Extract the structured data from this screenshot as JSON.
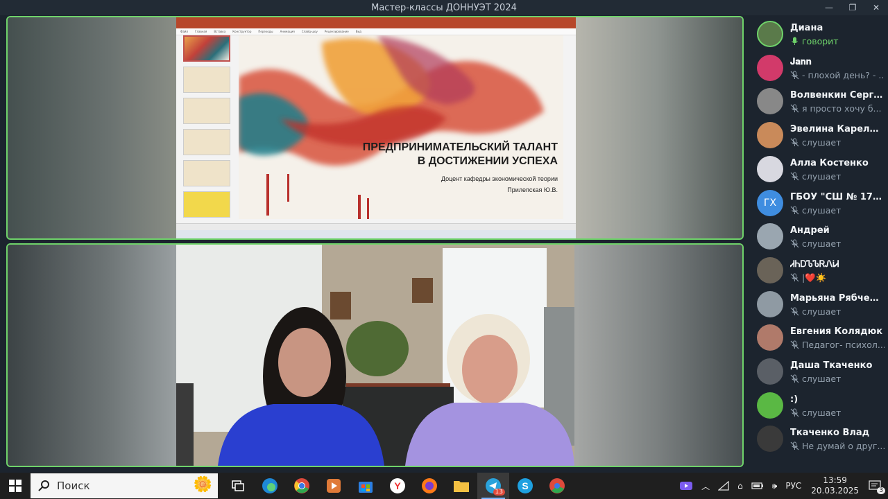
{
  "window": {
    "title": "Мастер-классы ДОННУЭТ 2024",
    "controls": [
      "minimize",
      "maximize",
      "close"
    ]
  },
  "slide": {
    "heading_line1": "ПРЕДПРИНИМАТЕЛЬСКИЙ ТАЛАНТ",
    "heading_line2": "В ДОСТИЖЕНИИ УСПЕХА",
    "subtitle": "Доцент кафедры экономической теории",
    "author": "Прилепская Ю.В."
  },
  "participants": [
    {
      "name": "Диана",
      "status": "говорит",
      "speaking": true,
      "avatar_color": "#5a7a4a",
      "initials": ""
    },
    {
      "name": "𝐉𝐚𝐧𝐧",
      "status": "- плохой день? - ...",
      "speaking": false,
      "avatar_color": "#d23a6a",
      "initials": ""
    },
    {
      "name": "Волвенкин Сергей",
      "status": "я просто хочу б...",
      "speaking": false,
      "avatar_color": "#888888",
      "initials": ""
    },
    {
      "name": "Эвелина Карелова",
      "status": "слушает",
      "speaking": false,
      "avatar_color": "#c98a5a",
      "initials": ""
    },
    {
      "name": "Алла Костенко",
      "status": "слушает",
      "speaking": false,
      "avatar_color": "#d8d8e0",
      "initials": ""
    },
    {
      "name": "ГБОУ \"СШ № 17 г....",
      "status": "слушает",
      "speaking": false,
      "avatar_color": "#3f8de0",
      "initials": "ГХ"
    },
    {
      "name": "Андрей",
      "status": "слушает",
      "speaking": false,
      "avatar_color": "#9aa6b0",
      "initials": ""
    },
    {
      "name": "ᏗᏂᎠᏖᏖᏒᏁᎥᏗ",
      "status": "|❤️☀️",
      "speaking": false,
      "avatar_color": "#6a6358",
      "initials": ""
    },
    {
      "name": "Марьяна Рябченко",
      "status": "слушает",
      "speaking": false,
      "avatar_color": "#8f9aa3",
      "initials": ""
    },
    {
      "name": "Евгения Колядюк",
      "status": "Педагог- психол...",
      "speaking": false,
      "avatar_color": "#b07a6a",
      "initials": ""
    },
    {
      "name": "Даша Ткаченко",
      "status": "слушает",
      "speaking": false,
      "avatar_color": "#5a5f66",
      "initials": ""
    },
    {
      "name": ":)",
      "status": "слушает",
      "speaking": false,
      "avatar_color": "#5ab844",
      "initials": ""
    },
    {
      "name": "Ткаченко Влад",
      "status": "Не думай о друг...",
      "speaking": false,
      "avatar_color": "#3a3a3a",
      "initials": ""
    }
  ],
  "taskbar": {
    "search_placeholder": "Поиск",
    "language": "РУС",
    "time": "13:59",
    "date": "20.03.2025",
    "telegram_badge": "13",
    "notifications_badge": "3"
  }
}
